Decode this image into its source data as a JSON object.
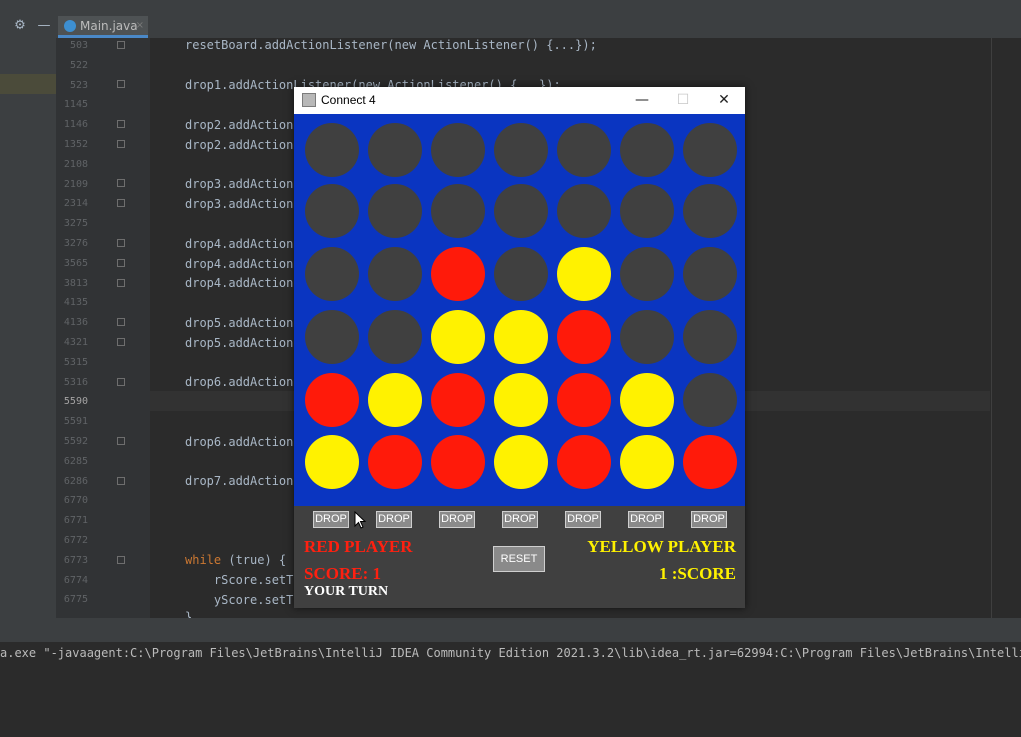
{
  "editor": {
    "tab_label": "Main.java",
    "tab_close": "×",
    "line_numbers": [
      "503",
      "522",
      "523",
      "1145",
      "1146",
      "1352",
      "2108",
      "2109",
      "2314",
      "3275",
      "3276",
      "3565",
      "3813",
      "4135",
      "4136",
      "4321",
      "5315",
      "5316",
      "5590",
      "5591",
      "5592",
      "6285",
      "6286",
      "6770",
      "6771",
      "6772",
      "6773",
      "6774",
      "6775"
    ],
    "code_lines": {
      "l503": "resetBoard.addActionListener(new ActionListener() {...});",
      "l523": "drop1.addActionListener(new ActionListener() {...});",
      "l1146": "drop2.addAction",
      "l1352": "drop2.addAction",
      "l2109": "drop3.addAction",
      "l2314": "drop3.addAction",
      "l3276": "drop4.addAction",
      "l3565": "drop4.addAction",
      "l3813": "drop4.addAction",
      "l4136": "drop5.addAction",
      "l4321": "drop5.addAction",
      "l5316": "drop6.addAction",
      "l5592": "drop6.addAction",
      "l6286": "drop7.addAction",
      "l6773_kw": "while",
      "l6773_rest": " (true) {",
      "l6774": "    rScore.setT",
      "l6775": "    yScore.setT",
      "l6776": "}"
    }
  },
  "console": {
    "line": "a.exe \"-javaagent:C:\\Program Files\\JetBrains\\IntelliJ IDEA Community Edition 2021.3.2\\lib\\idea_rt.jar=62994:C:\\Program Files\\JetBrains\\Intelli"
  },
  "game_window": {
    "title": "Connect 4",
    "minimize": "—",
    "maximize": "☐",
    "close": "✕",
    "colors": {
      "board": "#0a35c1",
      "empty": "#404040",
      "red": "#ff1a0a",
      "yellow": "#fff200"
    },
    "board": [
      [
        "empty",
        "empty",
        "empty",
        "empty",
        "empty",
        "empty",
        "empty"
      ],
      [
        "empty",
        "empty",
        "empty",
        "empty",
        "empty",
        "empty",
        "empty"
      ],
      [
        "empty",
        "empty",
        "red",
        "empty",
        "yellow",
        "empty",
        "empty"
      ],
      [
        "empty",
        "empty",
        "yellow",
        "yellow",
        "red",
        "empty",
        "empty"
      ],
      [
        "red",
        "yellow",
        "red",
        "yellow",
        "red",
        "yellow",
        "empty"
      ],
      [
        "yellow",
        "red",
        "red",
        "yellow",
        "red",
        "yellow",
        "red"
      ]
    ],
    "drop_label": "DROP",
    "red_player": "RED PLAYER",
    "red_score": "SCORE: 1",
    "yellow_player": "YELLOW PLAYER",
    "yellow_score": "1 :SCORE",
    "reset_label": "RESET",
    "turn_text": "YOUR TURN"
  },
  "toolbar_icons": [
    "gear-icon",
    "minimize-icon"
  ]
}
